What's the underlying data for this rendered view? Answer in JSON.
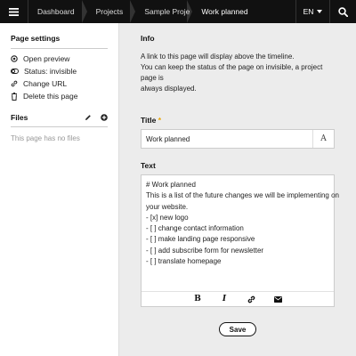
{
  "topbar": {
    "menu_icon": "hamburger-icon",
    "breadcrumbs": [
      "Dashboard",
      "Projects",
      "Sample Proje",
      "Work planned"
    ],
    "language": "EN",
    "search_icon": "search-icon"
  },
  "sidebar": {
    "page_settings": {
      "title": "Page settings",
      "items": [
        {
          "label": "Open preview",
          "icon": "preview-icon"
        },
        {
          "label": "Status: invisible",
          "icon": "toggle-icon"
        },
        {
          "label": "Change URL",
          "icon": "link-icon"
        },
        {
          "label": "Delete this page",
          "icon": "trash-icon"
        }
      ]
    },
    "files": {
      "title": "Files",
      "empty": "This page has no files",
      "edit_icon": "pencil-icon",
      "add_icon": "plus-circle-icon"
    }
  },
  "main": {
    "info": {
      "label": "Info",
      "line1": "A link to this page will display above the timeline.",
      "line2": "You can keep the status of the page on invisible, a project page is",
      "line3": "always displayed."
    },
    "title_field": {
      "label": "Title",
      "required_mark": "*",
      "value": "Work planned",
      "font_button": "A"
    },
    "text_field": {
      "label": "Text",
      "lines": [
        "# Work planned",
        "",
        "This is a list of the future changes we will be implementing on",
        "your website.",
        "",
        "- [x] new logo",
        "- [ ] change contact information",
        "- [ ] make landing page responsive",
        "- [ ] add subscribe form for newsletter",
        "- [ ] translate homepage"
      ],
      "toolbar": {
        "bold": "B",
        "italic": "I",
        "link_icon": "link-icon",
        "email_icon": "envelope-icon"
      }
    },
    "save_label": "Save"
  }
}
